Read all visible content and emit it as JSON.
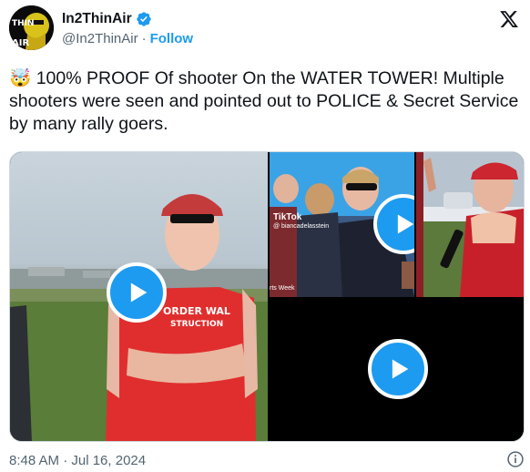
{
  "author": {
    "name": "In2ThinAir",
    "handle": "@In2ThinAir",
    "separator": "·",
    "follow_label": "Follow",
    "avatar_text_top": "THIN",
    "avatar_text_bottom": "AIR"
  },
  "tweet": {
    "emoji": "🤯",
    "text": " 100% PROOF Of shooter On the WATER TOWER! Multiple shooters were seen and pointed out to POLICE & Secret Service by many rally goers."
  },
  "media": {
    "shirt_text_line1": "ORDER WAL",
    "shirt_text_line2": "STRUCTION",
    "tiktok_label": "TikTok",
    "tiktok_user": "@ biancadelasstein",
    "sports_label": "rts Week"
  },
  "footer": {
    "timestamp": "8:48 AM · Jul 16, 2024"
  },
  "colors": {
    "accent": "#1d9bf0",
    "text": "#0f1419",
    "muted": "#536471"
  },
  "icons": {
    "verified": "verified-badge-icon",
    "x": "x-logo-icon",
    "play": "play-icon",
    "info": "info-icon"
  }
}
